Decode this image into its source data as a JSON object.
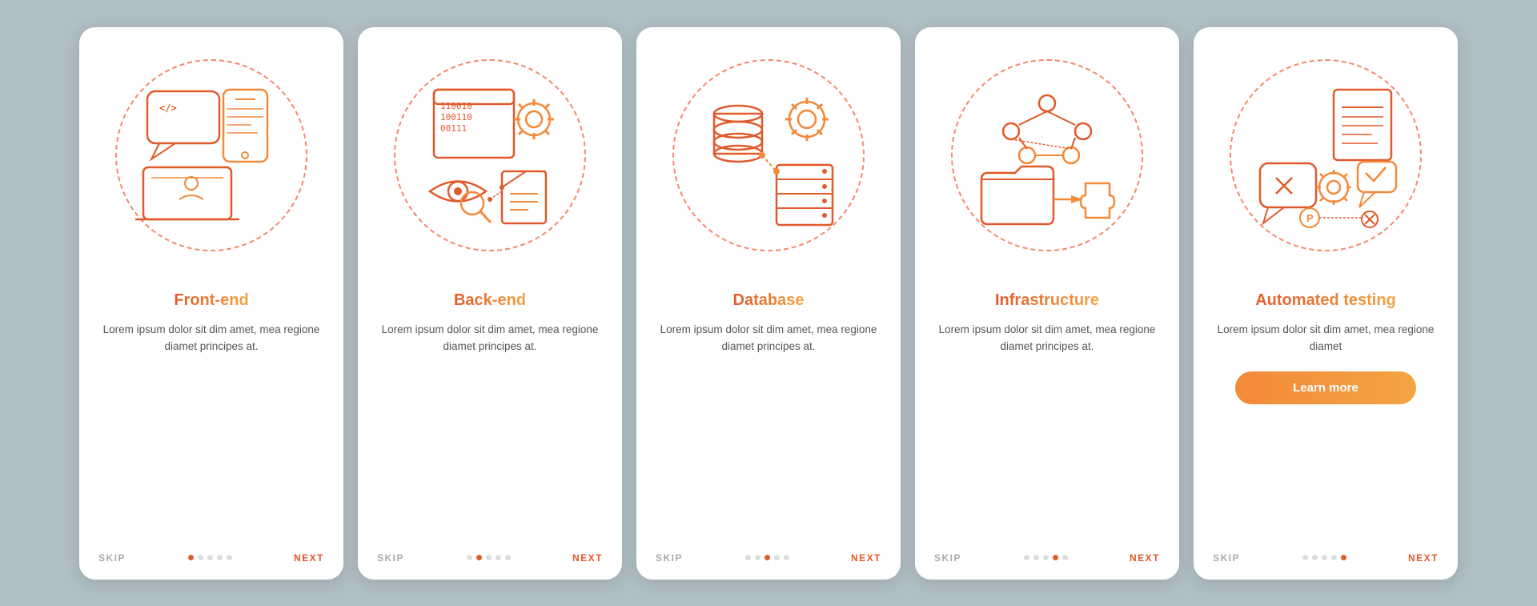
{
  "cards": [
    {
      "id": "frontend",
      "title": "Front-end",
      "body_text": "Lorem ipsum dolor sit dim amet, mea regione diamet principes at.",
      "skip_label": "SKIP",
      "next_label": "NEXT",
      "dots": [
        false,
        false,
        false,
        false,
        false
      ],
      "active_dot": 0,
      "has_learn_more": false
    },
    {
      "id": "backend",
      "title": "Back-end",
      "body_text": "Lorem ipsum dolor sit dim amet, mea regione diamet principes at.",
      "skip_label": "SKIP",
      "next_label": "NEXT",
      "dots": [
        false,
        false,
        false,
        false,
        false
      ],
      "active_dot": 1,
      "has_learn_more": false
    },
    {
      "id": "database",
      "title": "Database",
      "body_text": "Lorem ipsum dolor sit dim amet, mea regione diamet principes at.",
      "skip_label": "SKIP",
      "next_label": "NEXT",
      "dots": [
        false,
        false,
        false,
        false,
        false
      ],
      "active_dot": 2,
      "has_learn_more": false
    },
    {
      "id": "infrastructure",
      "title": "Infrastructure",
      "body_text": "Lorem ipsum dolor sit dim amet, mea regione diamet principes at.",
      "skip_label": "SKIP",
      "next_label": "NEXT",
      "dots": [
        false,
        false,
        false,
        false,
        false
      ],
      "active_dot": 3,
      "has_learn_more": false
    },
    {
      "id": "automated-testing",
      "title": "Automated testing",
      "body_text": "Lorem ipsum dolor sit dim amet, mea regione diamet",
      "skip_label": "SKIP",
      "next_label": "NEXT",
      "dots": [
        false,
        false,
        false,
        false,
        false
      ],
      "active_dot": 4,
      "has_learn_more": true,
      "learn_more_label": "Learn more"
    }
  ]
}
